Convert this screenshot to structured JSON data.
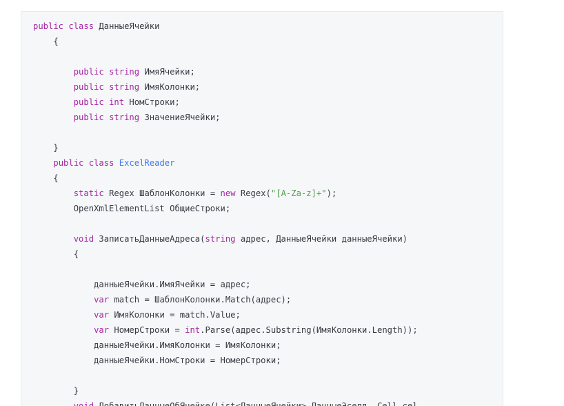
{
  "colors": {
    "keyword": "#a626a4",
    "class_name": "#4078f2",
    "string": "#50a14f",
    "text": "#383a42",
    "background": "#f6f7f9"
  },
  "code_lines": [
    [
      {
        "t": "public class ",
        "k": "kw"
      },
      {
        "t": "ДанныеЯчейки",
        "k": "id"
      }
    ],
    [
      {
        "t": "    {",
        "k": "id"
      }
    ],
    [],
    [
      {
        "t": "        ",
        "k": "id"
      },
      {
        "t": "public string ",
        "k": "kw"
      },
      {
        "t": "ИмяЯчейки;",
        "k": "id"
      }
    ],
    [
      {
        "t": "        ",
        "k": "id"
      },
      {
        "t": "public string ",
        "k": "kw"
      },
      {
        "t": "ИмяКолонки;",
        "k": "id"
      }
    ],
    [
      {
        "t": "        ",
        "k": "id"
      },
      {
        "t": "public int ",
        "k": "kw"
      },
      {
        "t": "НомСтроки;",
        "k": "id"
      }
    ],
    [
      {
        "t": "        ",
        "k": "id"
      },
      {
        "t": "public string ",
        "k": "kw"
      },
      {
        "t": "ЗначениеЯчейки;",
        "k": "id"
      }
    ],
    [],
    [
      {
        "t": "    }",
        "k": "id"
      }
    ],
    [
      {
        "t": "    ",
        "k": "id"
      },
      {
        "t": "public class ",
        "k": "kw"
      },
      {
        "t": "ExcelReader",
        "k": "cls"
      }
    ],
    [
      {
        "t": "    {",
        "k": "id"
      }
    ],
    [
      {
        "t": "        ",
        "k": "id"
      },
      {
        "t": "static ",
        "k": "kw"
      },
      {
        "t": "Regex ШаблонКолонки = ",
        "k": "id"
      },
      {
        "t": "new ",
        "k": "kw"
      },
      {
        "t": "Regex(",
        "k": "id"
      },
      {
        "t": "\"[A-Za-z]+\"",
        "k": "str"
      },
      {
        "t": ");",
        "k": "id"
      }
    ],
    [
      {
        "t": "        OpenXmlElementList ОбщиеСтроки;",
        "k": "id"
      }
    ],
    [],
    [
      {
        "t": "        ",
        "k": "id"
      },
      {
        "t": "void ",
        "k": "kw"
      },
      {
        "t": "ЗаписатьДанныеАдреса(",
        "k": "id"
      },
      {
        "t": "string ",
        "k": "kw"
      },
      {
        "t": "адрес, ДанныеЯчейки данныеЯчейки)",
        "k": "id"
      }
    ],
    [
      {
        "t": "        {",
        "k": "id"
      }
    ],
    [],
    [
      {
        "t": "            данныеЯчейки.ИмяЯчейки = адрес;",
        "k": "id"
      }
    ],
    [
      {
        "t": "            ",
        "k": "id"
      },
      {
        "t": "var ",
        "k": "kw"
      },
      {
        "t": "match = ШаблонКолонки.Match(адрес);",
        "k": "id"
      }
    ],
    [
      {
        "t": "            ",
        "k": "id"
      },
      {
        "t": "var ",
        "k": "kw"
      },
      {
        "t": "ИмяКолонки = match.Value;",
        "k": "id"
      }
    ],
    [
      {
        "t": "            ",
        "k": "id"
      },
      {
        "t": "var ",
        "k": "kw"
      },
      {
        "t": "НомерСтроки = ",
        "k": "id"
      },
      {
        "t": "int",
        "k": "kw"
      },
      {
        "t": ".Parse(адрес.Substring(ИмяКолонки.Length));",
        "k": "id"
      }
    ],
    [
      {
        "t": "            данныеЯчейки.ИмяКолонки = ИмяКолонки;",
        "k": "id"
      }
    ],
    [
      {
        "t": "            данныеЯчейки.НомСтроки = НомерСтроки;",
        "k": "id"
      }
    ],
    [],
    [
      {
        "t": "        }",
        "k": "id"
      }
    ],
    [
      {
        "t": "        ",
        "k": "id"
      },
      {
        "t": "void ",
        "k": "kw"
      },
      {
        "t": "ДобавитьДанныеОбЯчейке(List<ДанныеЯчейки> ДанныеЭселд, Cell cel",
        "k": "id"
      }
    ]
  ]
}
